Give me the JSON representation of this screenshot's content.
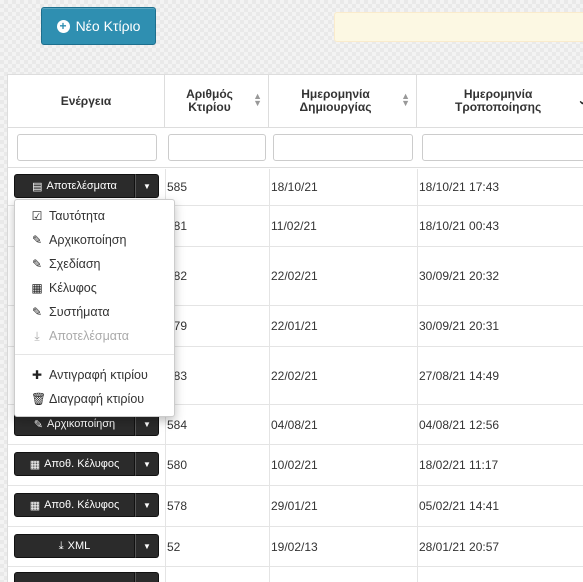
{
  "toolbar": {
    "new_building_label": "Νέο Κτίριο"
  },
  "columns": {
    "action": "Ενέργεια",
    "building_number_line1": "Αριθμός",
    "building_number_line2": "Κτιρίου",
    "created_line1": "Ημερομηνία",
    "created_line2": "Δημιουργίας",
    "modified_line1": "Ημερομηνία",
    "modified_line2": "Τροποποίησης"
  },
  "rows": [
    {
      "action": "Αποτελέσματα",
      "number": "585",
      "created": "18/10/21",
      "modified": "18/10/21 17:43"
    },
    {
      "action": "",
      "number": "581",
      "created": "11/02/21",
      "modified": "18/10/21 00:43"
    },
    {
      "action": "",
      "number": "582",
      "created": "22/02/21",
      "modified": "30/09/21 20:32"
    },
    {
      "action": "",
      "number": "579",
      "created": "22/01/21",
      "modified": "30/09/21 20:31"
    },
    {
      "action": "",
      "number": "583",
      "created": "22/02/21",
      "modified": "27/08/21 14:49"
    },
    {
      "action": "Αρχικοποίηση",
      "number": "584",
      "created": "04/08/21",
      "modified": "04/08/21 12:56"
    },
    {
      "action": "Αποθ. Κέλυφος",
      "number": "580",
      "created": "10/02/21",
      "modified": "18/02/21 11:17"
    },
    {
      "action": "Αποθ. Κέλυφος",
      "number": "578",
      "created": "29/01/21",
      "modified": "05/02/21 14:41"
    },
    {
      "action": "XML",
      "number": "52",
      "created": "19/02/13",
      "modified": "28/01/21 20:57"
    }
  ],
  "dropdown": {
    "identity": "Ταυτότητα",
    "initialization": "Αρχικοποίηση",
    "design": "Σχεδίαση",
    "shell": "Κέλυφος",
    "systems": "Συστήματα",
    "results": "Αποτελέσματα",
    "copy": "Αντιγραφή κτιρίου",
    "delete": "Διαγραφή κτιρίου"
  }
}
